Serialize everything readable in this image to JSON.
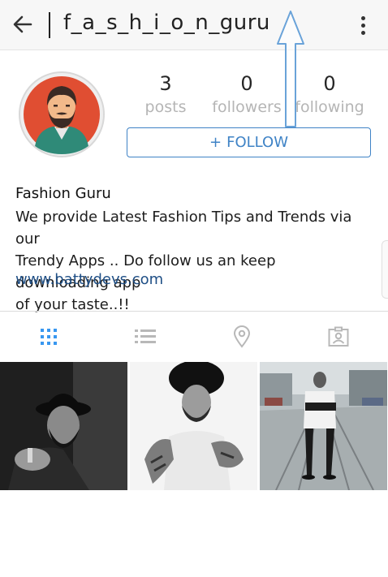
{
  "header": {
    "title": "f_a_s_h_i_o_n_guru",
    "back_icon": "arrow-left-icon",
    "menu_icon": "more-vertical-icon"
  },
  "stats": {
    "posts": {
      "count": "3",
      "label": "posts"
    },
    "followers": {
      "count": "0",
      "label": "followers"
    },
    "following": {
      "count": "0",
      "label": "following"
    }
  },
  "follow_button": {
    "plus": "+",
    "label": "FOLLOW"
  },
  "bio": {
    "name": "Fashion Guru",
    "line1": "We provide Latest Fashion Tips and Trends via our",
    "line2": "Trendy Apps .. Do follow us an keep downloading app",
    "line3": "of your taste..!!",
    "link": "www.battydevs.com"
  },
  "tabs": [
    {
      "icon": "grid-icon",
      "active": true
    },
    {
      "icon": "list-icon",
      "active": false
    },
    {
      "icon": "location-pin-icon",
      "active": false
    },
    {
      "icon": "tagged-person-icon",
      "active": false
    }
  ],
  "colors": {
    "accent": "#3f83c6",
    "active_tab": "#3897f0",
    "inactive_tab": "#b8b8b8",
    "link": "#1f4f86",
    "annotation_arrow": "#6aa3d9"
  }
}
